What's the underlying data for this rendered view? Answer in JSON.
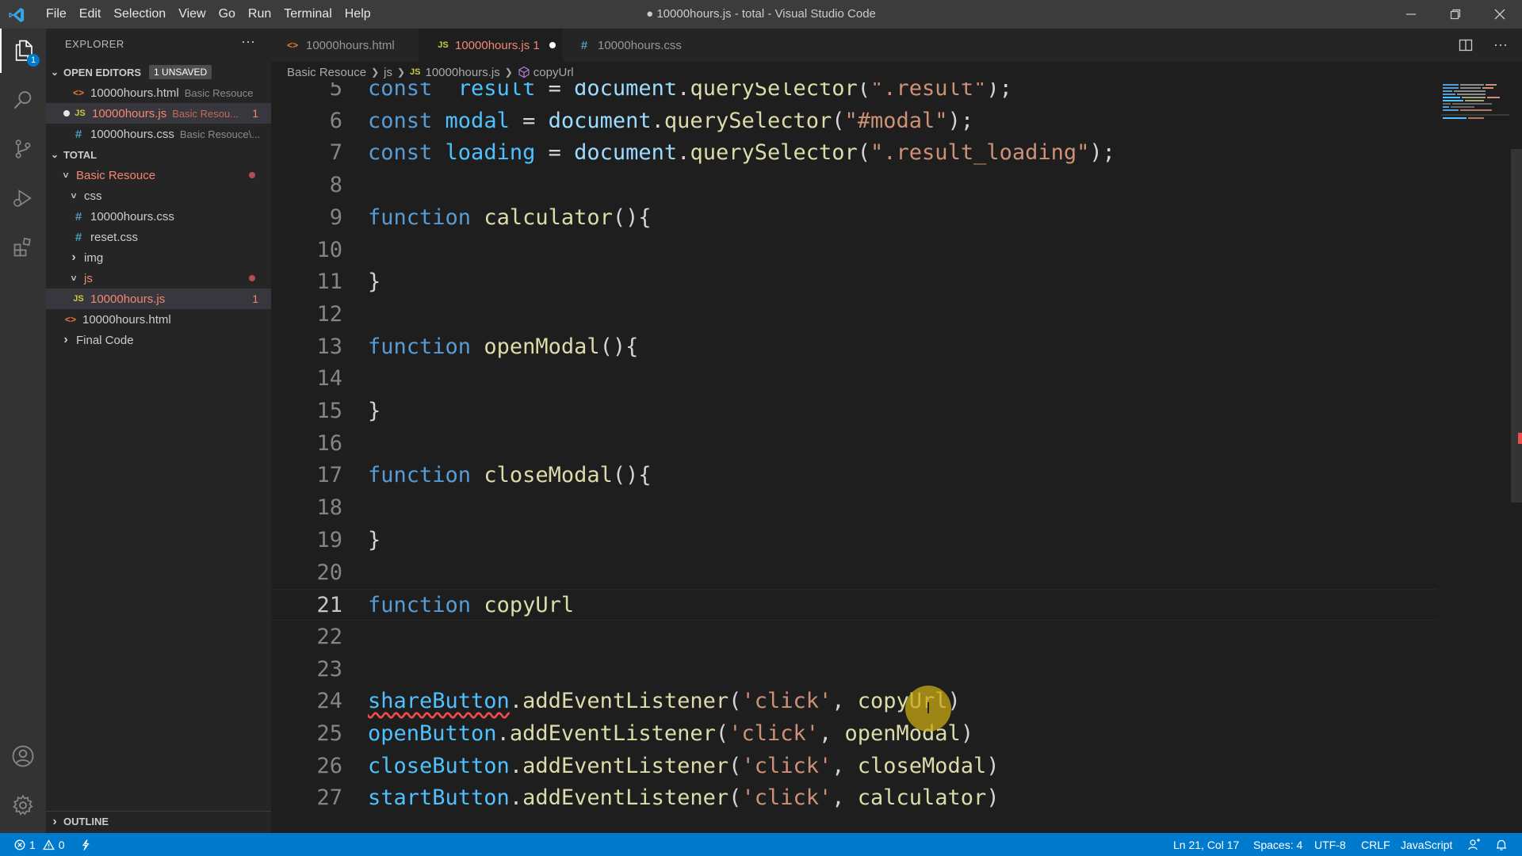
{
  "title_bar": {
    "menu": [
      "File",
      "Edit",
      "Selection",
      "View",
      "Go",
      "Run",
      "Terminal",
      "Help"
    ],
    "title": "● 10000hours.js - total - Visual Studio Code"
  },
  "activity_bar": {
    "explorer_badge": "1"
  },
  "sidebar": {
    "header": "EXPLORER",
    "more": "···",
    "open_editors": {
      "label": "OPEN EDITORS",
      "badge": "1 UNSAVED",
      "items": [
        {
          "icon": "<>",
          "name": "10000hours.html",
          "desc": "Basic Resouce"
        },
        {
          "icon": "JS",
          "name": "10000hours.js",
          "desc": "Basic Resou...",
          "count": "1"
        },
        {
          "icon": "#",
          "name": "10000hours.css",
          "desc": "Basic Resouce\\..."
        }
      ]
    },
    "workspace": {
      "label": "TOTAL",
      "tree": [
        {
          "icon": "˅",
          "name": "Basic Resouce"
        },
        {
          "icon": "˅",
          "name": "css"
        },
        {
          "icon": "#",
          "name": "10000hours.css"
        },
        {
          "icon": "#",
          "name": "reset.css"
        },
        {
          "icon": "›",
          "name": "img"
        },
        {
          "icon": "˅",
          "name": "js"
        },
        {
          "icon": "JS",
          "name": "10000hours.js",
          "count": "1"
        },
        {
          "icon": "<>",
          "name": "10000hours.html"
        },
        {
          "icon": "›",
          "name": "Final Code"
        }
      ]
    },
    "outline_label": "OUTLINE"
  },
  "tabs": [
    {
      "icon": "<>",
      "label": "10000hours.html"
    },
    {
      "icon": "JS",
      "label": "10000hours.js 1"
    },
    {
      "icon": "#",
      "label": "10000hours.css"
    }
  ],
  "breadcrumb": [
    "Basic Resouce",
    "js",
    "10000hours.js",
    "copyUrl"
  ],
  "editor": {
    "lines": [
      {
        "n": "5",
        "t": [
          [
            "kw",
            "const"
          ],
          [
            "",
            "  "
          ],
          [
            "var",
            "result"
          ],
          [
            "",
            " = "
          ],
          [
            "prop",
            "document"
          ],
          [
            "",
            "."
          ],
          [
            "fn",
            "querySelector"
          ],
          [
            "",
            "("
          ],
          [
            "str",
            "\".result\""
          ],
          [
            "",
            ");"
          ]
        ]
      },
      {
        "n": "6",
        "t": [
          [
            "kw",
            "const"
          ],
          [
            "",
            " "
          ],
          [
            "var",
            "modal"
          ],
          [
            "",
            " = "
          ],
          [
            "prop",
            "document"
          ],
          [
            "",
            "."
          ],
          [
            "fn",
            "querySelector"
          ],
          [
            "",
            "("
          ],
          [
            "str",
            "\"#modal\""
          ],
          [
            "",
            ");"
          ]
        ]
      },
      {
        "n": "7",
        "t": [
          [
            "kw",
            "const"
          ],
          [
            "",
            " "
          ],
          [
            "var",
            "loading"
          ],
          [
            "",
            " = "
          ],
          [
            "prop",
            "document"
          ],
          [
            "",
            "."
          ],
          [
            "fn",
            "querySelector"
          ],
          [
            "",
            "("
          ],
          [
            "str",
            "\".result_loading\""
          ],
          [
            "",
            ");"
          ]
        ]
      },
      {
        "n": "8",
        "t": []
      },
      {
        "n": "9",
        "t": [
          [
            "kw",
            "function"
          ],
          [
            "",
            " "
          ],
          [
            "fn",
            "calculator"
          ],
          [
            "",
            "(){"
          ]
        ]
      },
      {
        "n": "10",
        "t": []
      },
      {
        "n": "11",
        "t": [
          [
            "",
            "}"
          ]
        ]
      },
      {
        "n": "12",
        "t": []
      },
      {
        "n": "13",
        "t": [
          [
            "kw",
            "function"
          ],
          [
            "",
            " "
          ],
          [
            "fn",
            "openModal"
          ],
          [
            "",
            "(){"
          ]
        ]
      },
      {
        "n": "14",
        "t": []
      },
      {
        "n": "15",
        "t": [
          [
            "",
            "}"
          ]
        ]
      },
      {
        "n": "16",
        "t": []
      },
      {
        "n": "17",
        "t": [
          [
            "kw",
            "function"
          ],
          [
            "",
            " "
          ],
          [
            "fn",
            "closeModal"
          ],
          [
            "",
            "(){"
          ]
        ]
      },
      {
        "n": "18",
        "t": []
      },
      {
        "n": "19",
        "t": [
          [
            "",
            "}"
          ]
        ]
      },
      {
        "n": "20",
        "t": []
      },
      {
        "n": "21",
        "t": [
          [
            "kw",
            "function"
          ],
          [
            "",
            " "
          ],
          [
            "fn",
            "copyUrl"
          ]
        ]
      },
      {
        "n": "22",
        "t": []
      },
      {
        "n": "23",
        "t": []
      },
      {
        "n": "24",
        "t": [
          [
            "var squig",
            "shareButton"
          ],
          [
            "",
            "."
          ],
          [
            "fn",
            "addEventListener"
          ],
          [
            "",
            "("
          ],
          [
            "str",
            "'click'"
          ],
          [
            "",
            ", "
          ],
          [
            "fn",
            "copyUrl"
          ],
          [
            "",
            ")"
          ]
        ]
      },
      {
        "n": "25",
        "t": [
          [
            "var",
            "openButton"
          ],
          [
            "",
            "."
          ],
          [
            "fn",
            "addEventListener"
          ],
          [
            "",
            "("
          ],
          [
            "str",
            "'click'"
          ],
          [
            "",
            ", "
          ],
          [
            "fn",
            "openModal"
          ],
          [
            "",
            ")"
          ]
        ]
      },
      {
        "n": "26",
        "t": [
          [
            "var",
            "closeButton"
          ],
          [
            "",
            "."
          ],
          [
            "fn",
            "addEventListener"
          ],
          [
            "",
            "("
          ],
          [
            "str",
            "'click'"
          ],
          [
            "",
            ", "
          ],
          [
            "fn",
            "closeModal"
          ],
          [
            "",
            ")"
          ]
        ]
      },
      {
        "n": "27",
        "t": [
          [
            "var",
            "startButton"
          ],
          [
            "",
            "."
          ],
          [
            "fn",
            "addEventListener"
          ],
          [
            "",
            "("
          ],
          [
            "str",
            "'click'"
          ],
          [
            "",
            ", "
          ],
          [
            "fn",
            "calculator"
          ],
          [
            "",
            ")"
          ]
        ]
      }
    ],
    "current_line": "21",
    "cursor_glyph": "I"
  },
  "status_bar": {
    "errors": "1",
    "warnings": "0",
    "position": "Ln 21, Col 17",
    "spaces": "Spaces: 4",
    "encoding": "UTF-8",
    "eol": "CRLF",
    "language": "JavaScript"
  },
  "colors": {
    "accent": "#007acc",
    "error": "#f48771",
    "keyword": "#569cd6",
    "variable": "#4fc1ff",
    "function": "#dcdcaa",
    "string": "#ce9178"
  }
}
